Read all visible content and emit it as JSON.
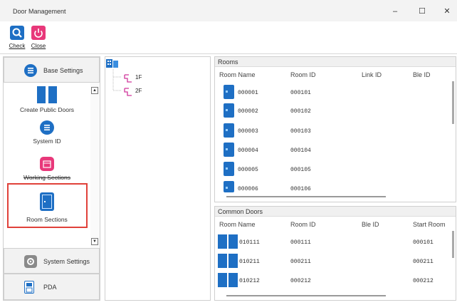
{
  "window": {
    "title": "Door Management",
    "minimize": "–",
    "maximize": "☐",
    "close": "✕"
  },
  "toolbar": {
    "check_label": "Check",
    "close_label": "Close"
  },
  "left_sections": {
    "base_settings": "Base Settings",
    "system_settings": "System Settings",
    "pda": "PDA",
    "items": [
      {
        "label": "Create Public Doors"
      },
      {
        "label": "System ID"
      },
      {
        "label": "Working Sections"
      },
      {
        "label": "Room Sections"
      }
    ]
  },
  "tree": {
    "floors": [
      "1F",
      "2F"
    ]
  },
  "rooms": {
    "title": "Rooms",
    "columns": [
      "Room Name",
      "Room ID",
      "Link ID",
      "Ble ID"
    ],
    "rows": [
      {
        "name": "000001",
        "id": "000101"
      },
      {
        "name": "000002",
        "id": "000102"
      },
      {
        "name": "000003",
        "id": "000103"
      },
      {
        "name": "000004",
        "id": "000104"
      },
      {
        "name": "000005",
        "id": "000105"
      },
      {
        "name": "000006",
        "id": "000106"
      }
    ]
  },
  "common_doors": {
    "title": "Common Doors",
    "columns": [
      "Room Name",
      "Room ID",
      "Ble ID",
      "Start Room"
    ],
    "rows": [
      {
        "name": "010111",
        "id": "000111",
        "start": "000101"
      },
      {
        "name": "010211",
        "id": "000211",
        "start": "000211"
      },
      {
        "name": "010212",
        "id": "000212",
        "start": "000212"
      }
    ]
  },
  "colors": {
    "accent_blue": "#1e6fc4",
    "close_pink": "#e8387a",
    "selection_red": "#e0413a",
    "tree_magenta": "#d0369b"
  }
}
